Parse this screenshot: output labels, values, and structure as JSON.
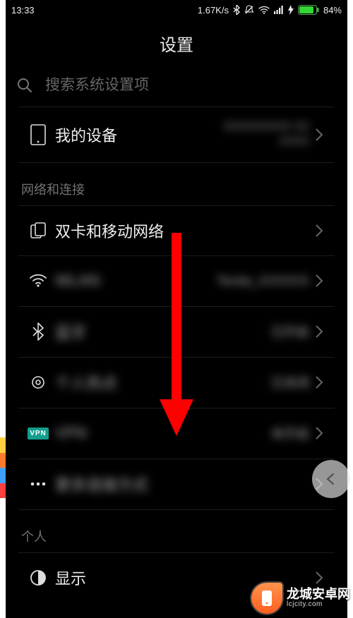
{
  "status": {
    "time": "13:33",
    "net_speed": "1.67K/s",
    "battery_pct": "84%"
  },
  "header": {
    "title": "设置"
  },
  "search": {
    "placeholder": "搜索系统设置项"
  },
  "my_device": {
    "label": "我的设备",
    "value_line1": "XXXXXXXXX XX",
    "value_line2": "XXXX"
  },
  "section_network": {
    "label": "网络和连接"
  },
  "rows": {
    "dual_sim": {
      "label": "双卡和移动网络"
    },
    "wifi": {
      "label": "WLAN",
      "value": "Tenda_XXXXXX"
    },
    "bt": {
      "label": "蓝牙",
      "value": "已开启"
    },
    "hotspot": {
      "label": "个人热点",
      "value": "已关闭"
    },
    "vpn": {
      "label": "VPN",
      "value": "未开启",
      "badge": "VPN"
    },
    "more": {
      "label": "更多连接方式"
    }
  },
  "section_personal": {
    "label": "个人"
  },
  "display": {
    "label": "显示"
  },
  "watermark": {
    "cn": "龙城安卓网",
    "en": "lcjcity.com"
  },
  "colors": {
    "accent": "#139e8e",
    "arrow": "#ff0000",
    "battery": "#34d634"
  }
}
